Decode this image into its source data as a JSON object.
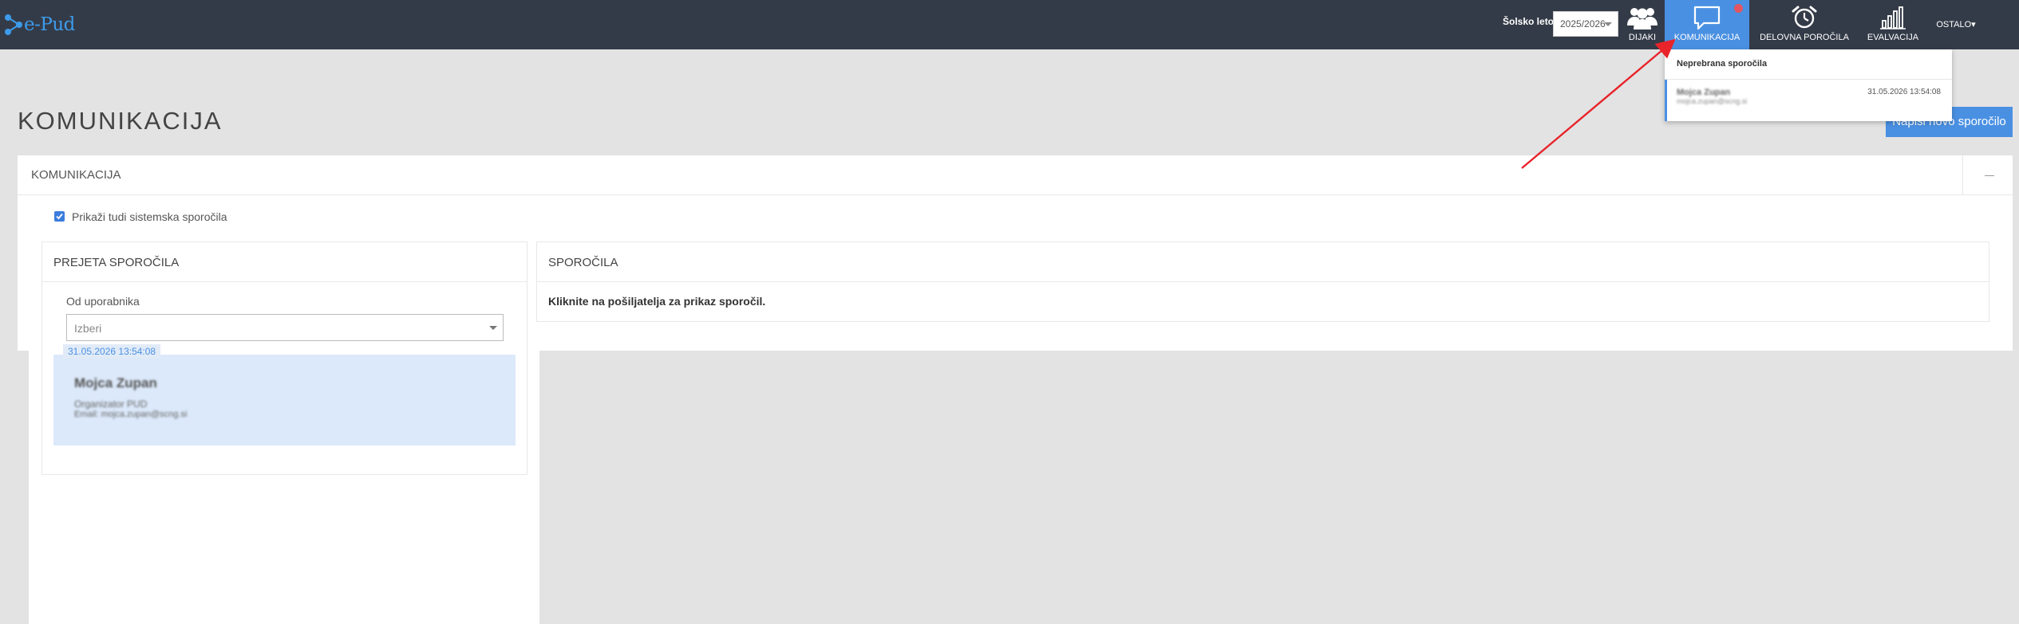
{
  "brand": {
    "logo_text": "e-Pud"
  },
  "header": {
    "year_label": "Šolsko leto:",
    "year_value": "2025/2026",
    "nav": [
      {
        "label": "DIJAKI",
        "icon": "users-icon"
      },
      {
        "label": "KOMUNIKACIJA",
        "icon": "chat-bubble-icon"
      },
      {
        "label": "DELOVNA POROČILA",
        "icon": "alarm-clock-icon"
      },
      {
        "label": "EVALVACIJA",
        "icon": "bar-chart-icon"
      },
      {
        "label": "OSTALO▾"
      }
    ]
  },
  "notifications": {
    "title": "Neprebrana sporočila",
    "items": [
      {
        "name": "Mojca Zupan",
        "email": "mojca.zupan@scng.si",
        "date": "31.05.2026 13:54:08"
      }
    ]
  },
  "page": {
    "title": "KOMUNIKACIJA",
    "new_message_button": "Napiši novo sporočilo",
    "panel_title": "KOMUNIKACIJA",
    "show_system_label": "Prikaži tudi sistemska sporočila",
    "show_system_checked": true
  },
  "received": {
    "title": "PREJETA SPOROČILA",
    "from_label": "Od uporabnika",
    "from_placeholder": "Izberi",
    "messages": [
      {
        "date": "31.05.2026 13:54:08",
        "name": "Mojca Zupan",
        "role": "Organizator PUD",
        "email": "Email: mojca.zupan@scng.si"
      }
    ]
  },
  "messages_panel": {
    "title": "SPOROČILA",
    "hint": "Kliknite na pošiljatelja za prikaz sporočil."
  },
  "colors": {
    "topbar": "#343b48",
    "accent": "#4a90e2",
    "selected_card": "#dce9fa",
    "annotation_arrow": "#e8232a"
  }
}
